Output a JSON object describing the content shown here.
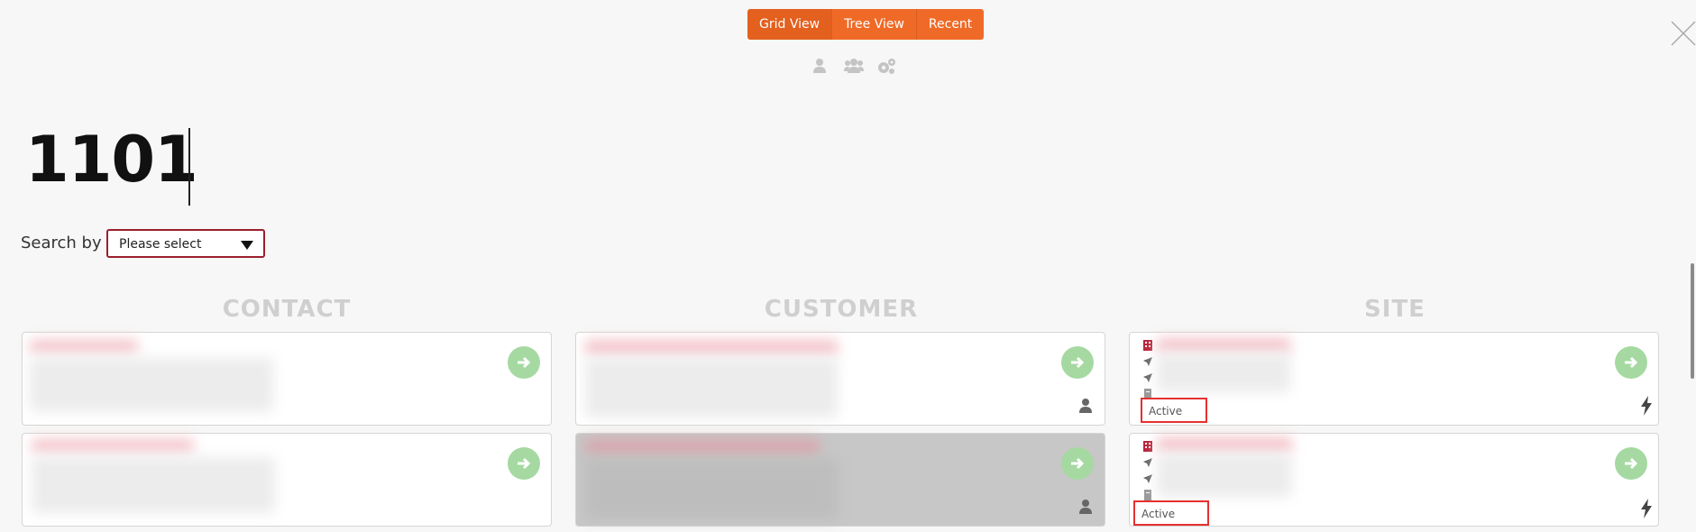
{
  "view_toggle": {
    "grid": "Grid View",
    "tree": "Tree View",
    "recent": "Recent"
  },
  "filter_icons": [
    "person-icon",
    "group-icon",
    "gears-icon"
  ],
  "search": {
    "query": "1101",
    "searchby_label": "Search by",
    "select_value": "Please select"
  },
  "columns": {
    "contact": "CONTACT",
    "customer": "CUSTOMER",
    "site": "SITE"
  },
  "site_cards": [
    {
      "status": "Active"
    },
    {
      "status": "Active"
    }
  ],
  "colors": {
    "accent": "#f06a27",
    "go_button": "#a5d9a1",
    "select_border": "#9a1f2e",
    "status_highlight": "#e63030"
  }
}
